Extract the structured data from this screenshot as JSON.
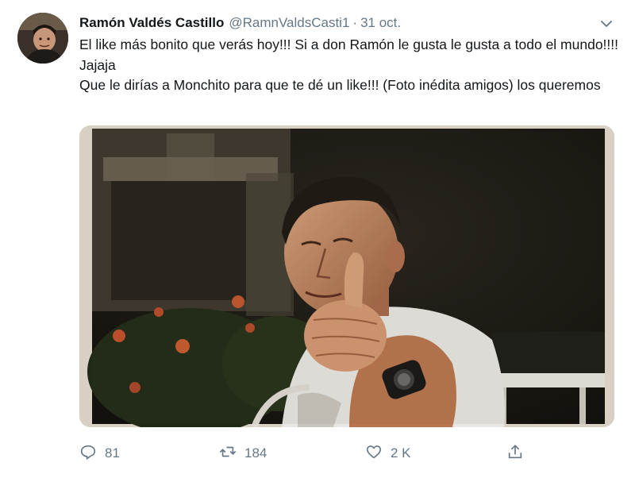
{
  "author": {
    "name": "Ramón Valdés Castillo",
    "handle": "@RamnValdsCasti1",
    "separator": "·",
    "date": "31 oct."
  },
  "tweet_text": {
    "line1": "El like más bonito que verás hoy!!! Si a don Ramón le gusta le gusta a todo el mundo!!!! Jajaja",
    "line2": "Que le dirías a Monchito para que te dé un like!!! (Foto inédita amigos) los queremos"
  },
  "actions": {
    "replies": "81",
    "retweets": "184",
    "likes": "2 K"
  },
  "icons": {
    "more": "chevron-down-icon",
    "reply": "reply-icon",
    "retweet": "retweet-icon",
    "like": "heart-icon",
    "share": "share-icon"
  },
  "colors": {
    "text": "#14171a",
    "muted": "#657786"
  }
}
